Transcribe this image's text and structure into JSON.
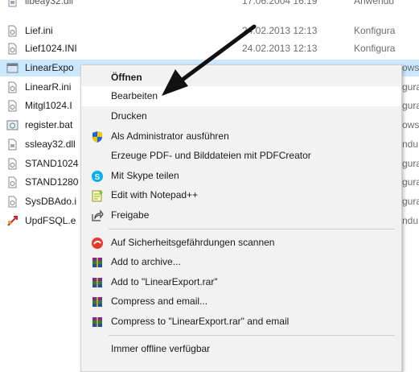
{
  "files": [
    {
      "name": "libeay32.dll",
      "date": "17.06.2004 16:19",
      "type": "Anwendu",
      "icon": "dll-file-icon"
    },
    {
      "name": "Lief.ini",
      "date": "24.02.2013 12:13",
      "type": "Konfigura",
      "icon": "ini-file-icon"
    },
    {
      "name": "Lief1024.INI",
      "date": "24.02.2013 12:13",
      "type": "Konfigura",
      "icon": "ini-file-icon"
    },
    {
      "name": "LinearExpo",
      "date": "",
      "type": "ows",
      "icon": "executable-file-icon"
    },
    {
      "name": "LinearR.ini",
      "date": "",
      "type": "gura",
      "icon": "ini-file-icon"
    },
    {
      "name": "Mitgl1024.I",
      "date": "",
      "type": "gura",
      "icon": "ini-file-icon"
    },
    {
      "name": "register.bat",
      "date": "",
      "type": "ows",
      "icon": "batch-file-icon"
    },
    {
      "name": "ssleay32.dll",
      "date": "",
      "type": "ndu",
      "icon": "dll-file-icon"
    },
    {
      "name": "STAND1024",
      "date": "",
      "type": "gura",
      "icon": "ini-file-icon"
    },
    {
      "name": "STAND1280",
      "date": "",
      "type": "gura",
      "icon": "ini-file-icon"
    },
    {
      "name": "SysDBAdo.i",
      "date": "",
      "type": "gura",
      "icon": "ini-file-icon"
    },
    {
      "name": "UpdFSQL.e",
      "date": "",
      "type": "ndu",
      "icon": "update-exe-icon"
    }
  ],
  "context_menu": {
    "items": {
      "open": "Öffnen",
      "edit": "Bearbeiten",
      "print": "Drucken",
      "run_as_admin": "Als Administrator ausführen",
      "pdfcreator": "Erzeuge PDF- und Bilddateien mit PDFCreator",
      "skype_share": "Mit Skype teilen",
      "notepadpp": "Edit with Notepad++",
      "share": "Freigabe",
      "scan": "Auf Sicherheitsgefährdungen scannen",
      "add_archive": "Add to archive...",
      "add_rar": "Add to \"LinearExport.rar\"",
      "compress_email": "Compress and email...",
      "compress_rar_email": "Compress to \"LinearExport.rar\" and email",
      "offline": "Immer offline verfügbar"
    }
  },
  "colors": {
    "selection": "#cce8ff",
    "menu_background": "#f2f2f2",
    "menu_highlight": "#ffffff",
    "skype_blue": "#00aff0",
    "shield_blue": "#1e66d0",
    "shield_yellow": "#f5c400",
    "scan_red": "#e53a2a",
    "rar_purple": "#7b2d8e",
    "arrow": "#111111"
  }
}
